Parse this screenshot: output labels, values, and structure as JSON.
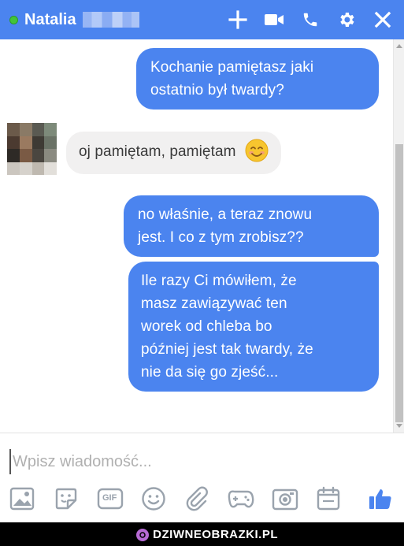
{
  "header": {
    "contact_name": "Natalia",
    "icons": [
      "add-person-icon",
      "video-call-icon",
      "phone-call-icon",
      "gear-icon",
      "close-icon"
    ]
  },
  "messages": [
    {
      "direction": "outgoing",
      "lines": [
        "Kochanie pamiętasz jaki",
        "ostatnio był twardy?"
      ]
    },
    {
      "direction": "incoming",
      "text": "oj pamiętam, pamiętam",
      "emoji": "smiling-face-icon"
    },
    {
      "direction": "outgoing",
      "lines": [
        "no właśnie, a teraz znowu",
        "jest. I co z tym zrobisz??"
      ]
    },
    {
      "direction": "outgoing",
      "lines": [
        "Ile razy Ci mówiłem, że",
        "masz zawiązywać ten",
        "worek od chleba bo",
        "później jest tak twardy, że",
        "nie da się go zjeść..."
      ]
    }
  ],
  "composer": {
    "placeholder": "Wpisz wiadomość...",
    "value": "",
    "tools": [
      "image-icon",
      "sticker-icon",
      "gif-icon",
      "emoji-icon",
      "attachment-icon",
      "game-icon",
      "camera-icon",
      "calendar-icon",
      "like-icon"
    ],
    "gif_label": "GIF"
  },
  "watermark": {
    "text": "DZIWNEOBRAZKI.PL"
  },
  "colors": {
    "accent": "#4b84ef",
    "incoming_bubble": "#f1f0f0",
    "online": "#42c43a"
  }
}
